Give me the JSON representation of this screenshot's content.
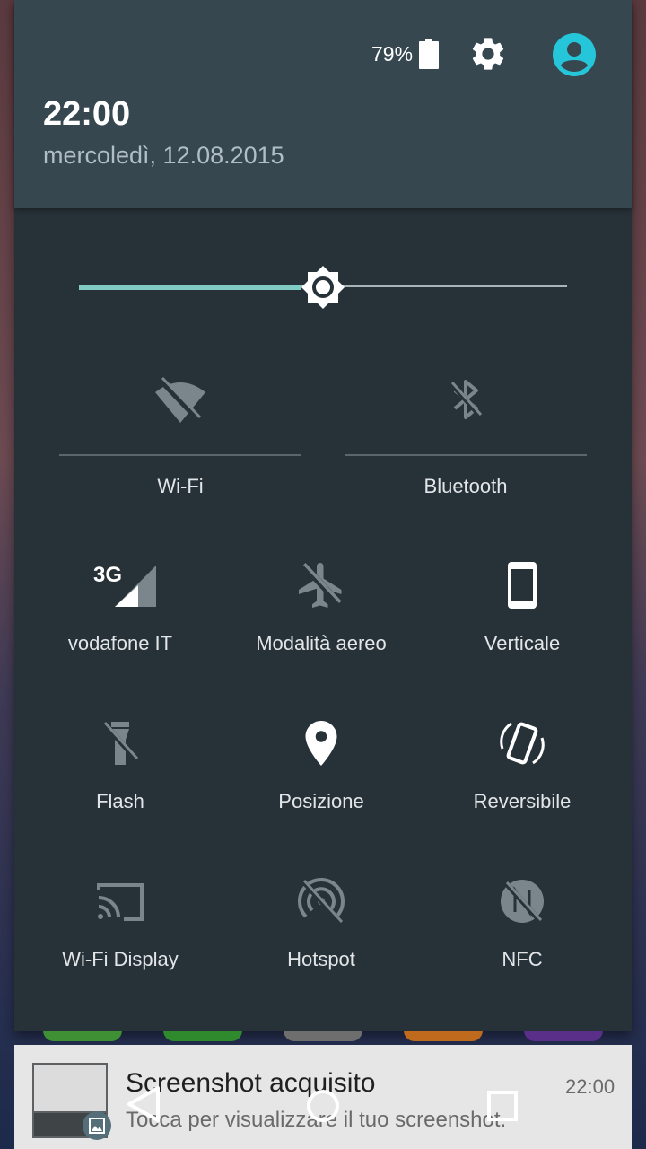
{
  "status": {
    "battery_percent": "79%",
    "battery_level": 0.79
  },
  "header": {
    "time": "22:00",
    "date": "mercoledì, 12.08.2015"
  },
  "brightness": {
    "level": 0.5
  },
  "tiles": {
    "wifi": "Wi-Fi",
    "bluetooth": "Bluetooth",
    "mobile_data": "vodafone IT",
    "mobile_data_badge": "3G",
    "airplane": "Modalità aereo",
    "orientation": "Verticale",
    "flashlight": "Flash",
    "location": "Posizione",
    "reversible": "Reversibile",
    "cast": "Wi-Fi Display",
    "hotspot": "Hotspot",
    "nfc": "NFC"
  },
  "notification": {
    "title": "Screenshot acquisito",
    "text": "Tocca per visualizzare il tuo screenshot.",
    "time": "22:00"
  },
  "icons": {
    "accent": "#80cbc4",
    "user_avatar_color": "#26c6da"
  }
}
